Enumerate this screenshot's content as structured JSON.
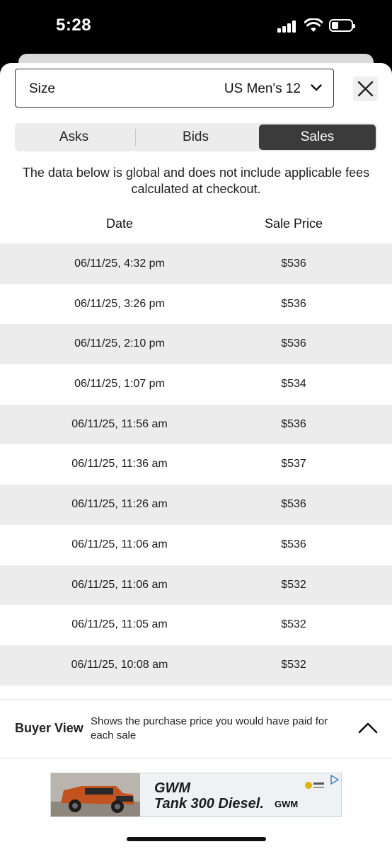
{
  "status_bar": {
    "time": "5:28"
  },
  "size_selector": {
    "label": "Size",
    "value": "US Men's 12"
  },
  "tabs": [
    {
      "label": "Asks",
      "active": false
    },
    {
      "label": "Bids",
      "active": false
    },
    {
      "label": "Sales",
      "active": true
    }
  ],
  "notice": "The data below is global and does not include applicable fees calculated at checkout.",
  "table": {
    "headers": {
      "date": "Date",
      "price": "Sale Price"
    },
    "rows": [
      {
        "date": "06/11/25, 4:32 pm",
        "price": "$536"
      },
      {
        "date": "06/11/25, 3:26 pm",
        "price": "$536"
      },
      {
        "date": "06/11/25, 2:10 pm",
        "price": "$536"
      },
      {
        "date": "06/11/25, 1:07 pm",
        "price": "$534"
      },
      {
        "date": "06/11/25, 11:56 am",
        "price": "$536"
      },
      {
        "date": "06/11/25, 11:36 am",
        "price": "$537"
      },
      {
        "date": "06/11/25, 11:26 am",
        "price": "$536"
      },
      {
        "date": "06/11/25, 11:06 am",
        "price": "$536"
      },
      {
        "date": "06/11/25, 11:06 am",
        "price": "$532"
      },
      {
        "date": "06/11/25, 11:05 am",
        "price": "$532"
      },
      {
        "date": "06/11/25, 10:08 am",
        "price": "$532"
      }
    ]
  },
  "buyer_view": {
    "title": "Buyer View",
    "description": "Shows the purchase price you would have paid for each sale"
  },
  "ad": {
    "brand": "GWM",
    "model": "Tank 300 Diesel.",
    "logo_text": "GWM"
  },
  "colors": {
    "active_tab": "#3b3b3b",
    "row_stripe": "#ececec"
  }
}
